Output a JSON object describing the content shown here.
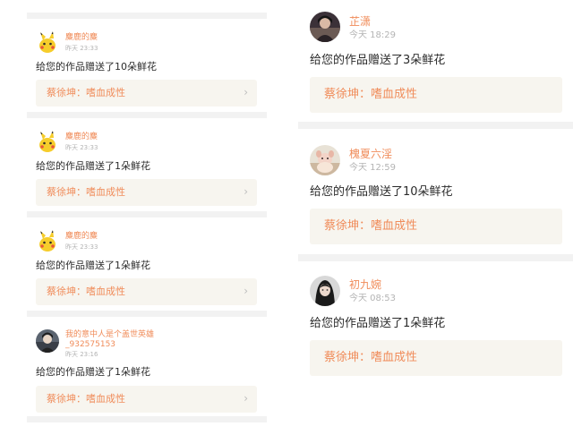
{
  "left_feed": {
    "items": [
      {
        "username": "麋鹿的麋",
        "time": "昨天 23:33",
        "message": "给您的作品赠送了10朵鲜花",
        "work_title": "蔡徐坤：嗜血成性",
        "avatar": "pikachu-avatar"
      },
      {
        "username": "麋鹿的麋",
        "time": "昨天 23:33",
        "message": "给您的作品赠送了1朵鲜花",
        "work_title": "蔡徐坤：嗜血成性",
        "avatar": "pikachu-avatar"
      },
      {
        "username": "麋鹿的麋",
        "time": "昨天 23:33",
        "message": "给您的作品赠送了1朵鲜花",
        "work_title": "蔡徐坤：嗜血成性",
        "avatar": "pikachu-avatar"
      },
      {
        "username": "我的意中人是个盖世英雄",
        "username_line2": "_932575153",
        "time": "昨天 23:16",
        "message": "给您的作品赠送了1朵鲜花",
        "work_title": "蔡徐坤：嗜血成性",
        "avatar": "person-avatar"
      }
    ],
    "chevron": "›"
  },
  "right_feed": {
    "items": [
      {
        "username": "芷潇",
        "time": "今天 18:29",
        "message": "给您的作品赠送了3朵鲜花",
        "work_title": "蔡徐坤：嗜血成性",
        "avatar": "photo-avatar"
      },
      {
        "username": "槐夏六淫",
        "time": "今天 12:59",
        "message": "给您的作品赠送了10朵鲜花",
        "work_title": "蔡徐坤：嗜血成性",
        "avatar": "photo-avatar"
      },
      {
        "username": "初九婉",
        "time": "今天 08:53",
        "message": "给您的作品赠送了1朵鲜花",
        "work_title": "蔡徐坤：嗜血成性",
        "avatar": "photo-avatar"
      }
    ]
  },
  "colors": {
    "accent": "#f08c5a",
    "work_bg": "#f7f5ef",
    "separator": "#f2f2f2",
    "text": "#2b2b2b",
    "muted": "#b4b4b4"
  }
}
